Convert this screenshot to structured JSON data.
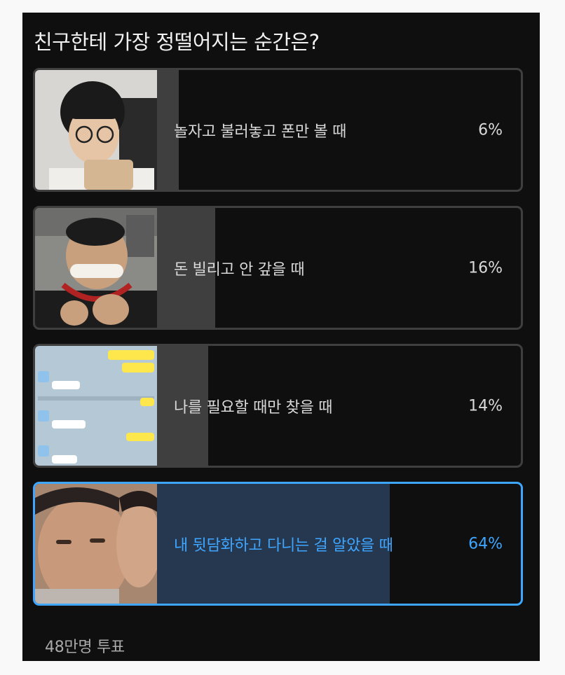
{
  "poll": {
    "title": "친구한테 가장 정떨어지는 순간은?",
    "options": [
      {
        "label": "놀자고 불러놓고 폰만 볼 때",
        "percent_text": "6%",
        "percent": 6,
        "selected": false,
        "thumbnail": "person-with-glasses-holding-phone-photo"
      },
      {
        "label": "돈 빌리고 안 갚을 때",
        "percent_text": "16%",
        "percent": 16,
        "selected": false,
        "thumbnail": "laughing-man-with-headphones-photo"
      },
      {
        "label": "나를 필요할 때만 찾을 때",
        "percent_text": "14%",
        "percent": 14,
        "selected": false,
        "thumbnail": "messenger-chat-screenshot"
      },
      {
        "label": "내 뒷담화하고 다니는 걸 알았을 때",
        "percent_text": "64%",
        "percent": 64,
        "selected": true,
        "thumbnail": "two-men-close-up-photo"
      }
    ],
    "vote_count": "48만명 투표"
  },
  "colors": {
    "background": "#0f0f0f",
    "border": "#3f3f3f",
    "fill": "#3f3f3f",
    "selected_accent": "#3ea6ff",
    "selected_fill": "#263850",
    "text": "#d9d9d9"
  }
}
